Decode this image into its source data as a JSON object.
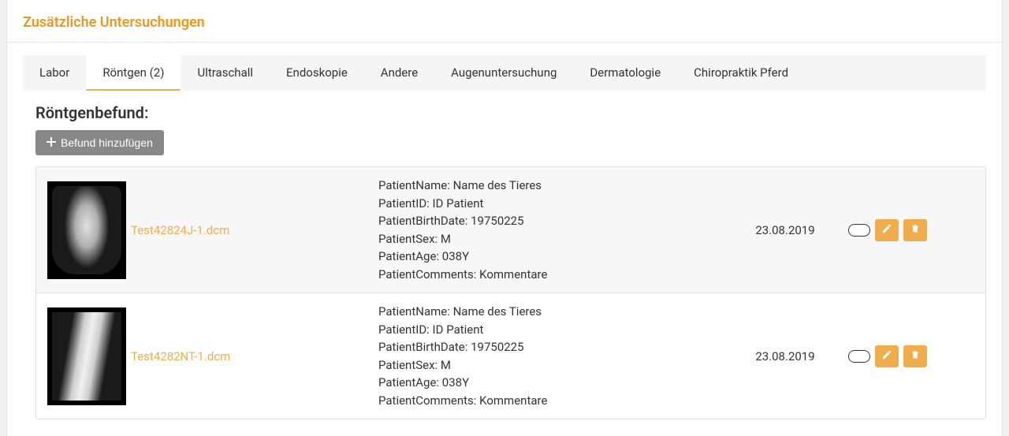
{
  "panel": {
    "title": "Zusätzliche Untersuchungen"
  },
  "tabs": [
    {
      "label": "Labor"
    },
    {
      "label": "Röntgen (2)"
    },
    {
      "label": "Ultraschall"
    },
    {
      "label": "Endoskopie"
    },
    {
      "label": "Andere"
    },
    {
      "label": "Augenuntersuchung"
    },
    {
      "label": "Dermatologie"
    },
    {
      "label": "Chiropraktik Pferd"
    }
  ],
  "section": {
    "title": "Röntgenbefund:"
  },
  "buttons": {
    "add_finding": "Befund hinzufügen"
  },
  "meta_labels": {
    "patient_name": "PatientName:",
    "patient_id": "PatientID:",
    "patient_birth": "PatientBirthDate:",
    "patient_sex": "PatientSex:",
    "patient_age": "PatientAge:",
    "patient_comments": "PatientComments:"
  },
  "rows": [
    {
      "filename": "Test42824J-1.dcm",
      "patient_name": "Name des Tieres",
      "patient_id": "ID Patient",
      "patient_birth": "19750225",
      "patient_sex": "M",
      "patient_age": "038Y",
      "patient_comments": "Kommentare",
      "date": "23.08.2019"
    },
    {
      "filename": "Test4282NT-1.dcm",
      "patient_name": "Name des Tieres",
      "patient_id": "ID Patient",
      "patient_birth": "19750225",
      "patient_sex": "M",
      "patient_age": "038Y",
      "patient_comments": "Kommentare",
      "date": "23.08.2019"
    }
  ]
}
